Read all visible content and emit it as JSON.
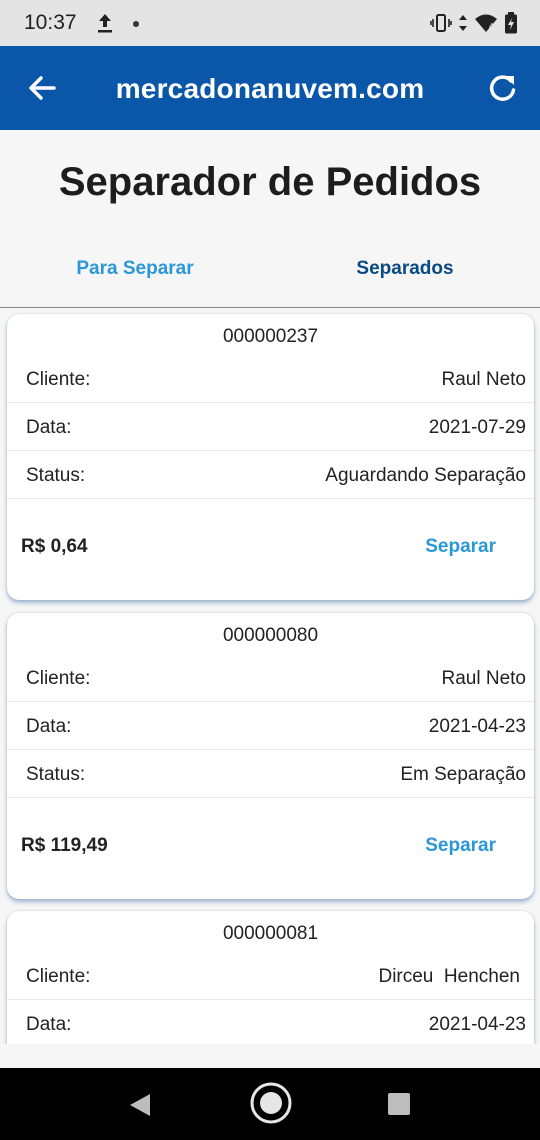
{
  "status_bar": {
    "time": "10:37",
    "icons": [
      "upload-icon",
      "notification-dot-icon",
      "vibrate-icon",
      "data-arrows-icon",
      "wifi-icon",
      "battery-icon"
    ]
  },
  "app_bar": {
    "title": "mercadonanuvem.com",
    "background": "#0a56a8",
    "back_icon": "arrow-left-icon",
    "refresh_icon": "refresh-icon"
  },
  "page": {
    "title": "Separador de Pedidos"
  },
  "tabs": [
    {
      "label": "Para Separar"
    },
    {
      "label": "Separados"
    }
  ],
  "orders": [
    {
      "id": "000000237",
      "rows": [
        {
          "label": "Cliente:",
          "value": "Raul Neto"
        },
        {
          "label": "Data:",
          "value": "2021-07-29"
        },
        {
          "label": "Status:",
          "value": "Aguardando Separação"
        }
      ],
      "total": "R$ 0,64",
      "action": "Separar"
    },
    {
      "id": "000000080",
      "rows": [
        {
          "label": "Cliente:",
          "value": "Raul Neto"
        },
        {
          "label": "Data:",
          "value": "2021-04-23"
        },
        {
          "label": "Status:",
          "value": "Em Separação"
        }
      ],
      "total": "R$ 119,49",
      "action": "Separar"
    },
    {
      "id": "000000081",
      "rows": [
        {
          "label": "Cliente:",
          "value": "Dirceu  Henchen"
        },
        {
          "label": "Data:",
          "value": "2021-04-23"
        }
      ]
    }
  ],
  "colors": {
    "accent": "#2a97d6",
    "tab_selected": "#0a4a82"
  },
  "nav_bar": {
    "icons": [
      "nav-back-icon",
      "nav-home-icon",
      "nav-recents-icon"
    ]
  }
}
